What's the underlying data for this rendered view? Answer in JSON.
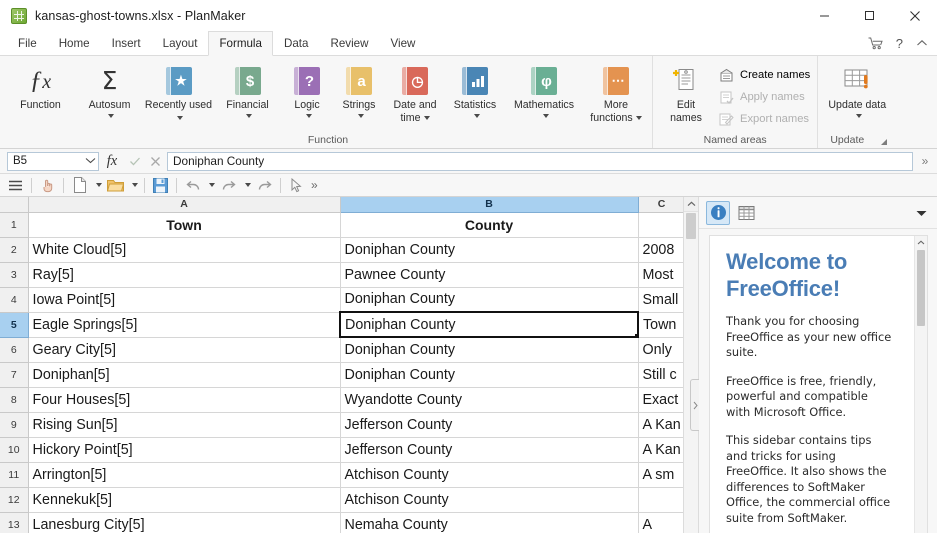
{
  "window": {
    "title": "kansas-ghost-towns.xlsx - PlanMaker",
    "app_icon": "planmaker-document-icon",
    "controls": [
      {
        "name": "minimize",
        "glyph": "minimize-icon"
      },
      {
        "name": "maximize",
        "glyph": "maximize-icon"
      },
      {
        "name": "close",
        "glyph": "close-icon"
      }
    ]
  },
  "tabs": {
    "items": [
      {
        "label": "File",
        "active": false
      },
      {
        "label": "Home",
        "active": false
      },
      {
        "label": "Insert",
        "active": false
      },
      {
        "label": "Layout",
        "active": false
      },
      {
        "label": "Formula",
        "active": true
      },
      {
        "label": "Data",
        "active": false
      },
      {
        "label": "Review",
        "active": false
      },
      {
        "label": "View",
        "active": false
      }
    ],
    "right_icons": [
      {
        "name": "shopping-cart-icon"
      },
      {
        "name": "help-question-icon"
      },
      {
        "name": "collapse-ribbon-chevron-icon"
      }
    ]
  },
  "ribbon": {
    "groups": [
      {
        "label": "Function",
        "buttons": [
          {
            "label": "Function",
            "icon": "fx-icon",
            "icon_kind": "fx",
            "dropdown": false
          },
          {
            "label": "Autosum",
            "icon": "sigma-icon",
            "icon_kind": "sigma",
            "dropdown": true
          },
          {
            "label": "Recently used",
            "icon": "star-book-icon",
            "icon_kind": "book",
            "glyph": "★",
            "color": "#5b9bc4",
            "dropdown": true,
            "inline_caret": true
          },
          {
            "label": "Financial",
            "icon": "dollar-book-icon",
            "icon_kind": "book",
            "glyph": "$",
            "color": "#79a98e",
            "dropdown": true
          },
          {
            "label": "Logic",
            "icon": "question-book-icon",
            "icon_kind": "book",
            "glyph": "?",
            "color": "#9b6fb5",
            "dropdown": true
          },
          {
            "label": "Strings",
            "icon": "letter-a-book-icon",
            "icon_kind": "book",
            "glyph": "a",
            "color": "#e8c06a",
            "dropdown": true
          },
          {
            "label": "Date and time",
            "icon": "clock-book-icon",
            "icon_kind": "book",
            "glyph": "◴",
            "color": "#d9695a",
            "dropdown": true,
            "inline_caret": true
          },
          {
            "label": "Statistics",
            "icon": "bar-chart-book-icon",
            "icon_kind": "book",
            "glyph": "▃▅▇",
            "color": "#4a86b5",
            "dropdown": true
          },
          {
            "label": "Mathematics",
            "icon": "phi-book-icon",
            "icon_kind": "book",
            "glyph": "φ",
            "color": "#6aaf94",
            "dropdown": true
          },
          {
            "label": "More functions",
            "icon": "ellipsis-book-icon",
            "icon_kind": "book",
            "glyph": "···",
            "color": "#e49350",
            "dropdown": true,
            "inline_caret": true
          }
        ]
      },
      {
        "label": "Named areas",
        "big_button": {
          "label": "Edit names",
          "icon": "edit-names-icon"
        },
        "small_buttons": [
          {
            "label": "Create names",
            "icon": "create-names-icon",
            "disabled": false
          },
          {
            "label": "Apply names",
            "icon": "apply-names-icon",
            "disabled": true
          },
          {
            "label": "Export names",
            "icon": "export-names-icon",
            "disabled": true
          }
        ]
      },
      {
        "label": "Update",
        "has_dialog_launcher": true,
        "big_button": {
          "label": "Update data",
          "icon": "update-data-icon",
          "dropdown": true
        }
      }
    ]
  },
  "formula_bar": {
    "name_box_value": "B5",
    "name_box_caret": "chevron-down-icon",
    "fx_label": "fx",
    "accept_icon": "check-icon",
    "cancel_icon": "x-icon",
    "input_value": "Doniphan County",
    "overflow_glyph": "»"
  },
  "quick_access_toolbar": {
    "buttons": [
      {
        "name": "menu-hamburger-icon"
      },
      {
        "name": "touch-mode-icon"
      },
      {
        "name": "new-document-icon",
        "dropdown": true
      },
      {
        "name": "open-folder-icon",
        "dropdown": true
      },
      {
        "name": "save-icon"
      },
      {
        "name": "undo-icon",
        "dropdown": true
      },
      {
        "name": "redo-icon",
        "dropdown": true
      },
      {
        "name": "repeat-icon"
      },
      {
        "name": "select-cursor-icon"
      }
    ],
    "overflow_glyph": "»"
  },
  "sheet": {
    "columns": [
      {
        "letter": "A",
        "selected": false
      },
      {
        "letter": "B",
        "selected": true
      },
      {
        "letter": "C",
        "selected": false
      }
    ],
    "selected_cell": "B5",
    "rows": [
      {
        "num": "1",
        "selected": false,
        "A": "Town",
        "B": "County",
        "C": ""
      },
      {
        "num": "2",
        "selected": false,
        "A": "White Cloud[5]",
        "B": "Doniphan County",
        "C": "2008"
      },
      {
        "num": "3",
        "selected": false,
        "A": "Ray[5]",
        "B": "Pawnee County",
        "C": "Most"
      },
      {
        "num": "4",
        "selected": false,
        "A": "Iowa Point[5]",
        "B": "Doniphan County",
        "C": "Small"
      },
      {
        "num": "5",
        "selected": true,
        "A": "Eagle Springs[5]",
        "B": "Doniphan County",
        "C": "Town"
      },
      {
        "num": "6",
        "selected": false,
        "A": "Geary City[5]",
        "B": "Doniphan County",
        "C": "Only"
      },
      {
        "num": "7",
        "selected": false,
        "A": "Doniphan[5]",
        "B": "Doniphan County",
        "C": "Still c"
      },
      {
        "num": "8",
        "selected": false,
        "A": "Four Houses[5]",
        "B": "Wyandotte County",
        "C": "Exact"
      },
      {
        "num": "9",
        "selected": false,
        "A": "Rising Sun[5]",
        "B": "Jefferson County",
        "C": "A Kan"
      },
      {
        "num": "10",
        "selected": false,
        "A": "Hickory Point[5]",
        "B": "Jefferson County",
        "C": "A Kan"
      },
      {
        "num": "11",
        "selected": false,
        "A": "Arrington[5]",
        "B": "Atchison County",
        "C": "A sm"
      },
      {
        "num": "12",
        "selected": false,
        "A": "Kennekuk[5]",
        "B": "Atchison County",
        "C": ""
      },
      {
        "num": "13",
        "selected": false,
        "A": "Lanesburg City[5]",
        "B": "Nemaha County",
        "C": "A"
      }
    ]
  },
  "sidebar": {
    "tabs": [
      {
        "name": "info-tips-icon",
        "active": true
      },
      {
        "name": "sheet-table-icon",
        "active": false
      }
    ],
    "menu_icon": "chevron-down-icon",
    "heading": "Welcome to FreeOffice!",
    "paragraphs": [
      "Thank you for choosing FreeOffice as your new office suite.",
      "FreeOffice is free, friendly, powerful and compatible with Microsoft Office.",
      "This sidebar contains tips and tricks for using FreeOffice. It also shows the differences to SoftMaker Office, the commercial office suite from SoftMaker."
    ]
  },
  "colors": {
    "accent_blue": "#4a7db5",
    "selection_header": "#a8d0f0",
    "ribbon_bg": "#f7f7f7",
    "grid_line": "#d6d6d6"
  }
}
